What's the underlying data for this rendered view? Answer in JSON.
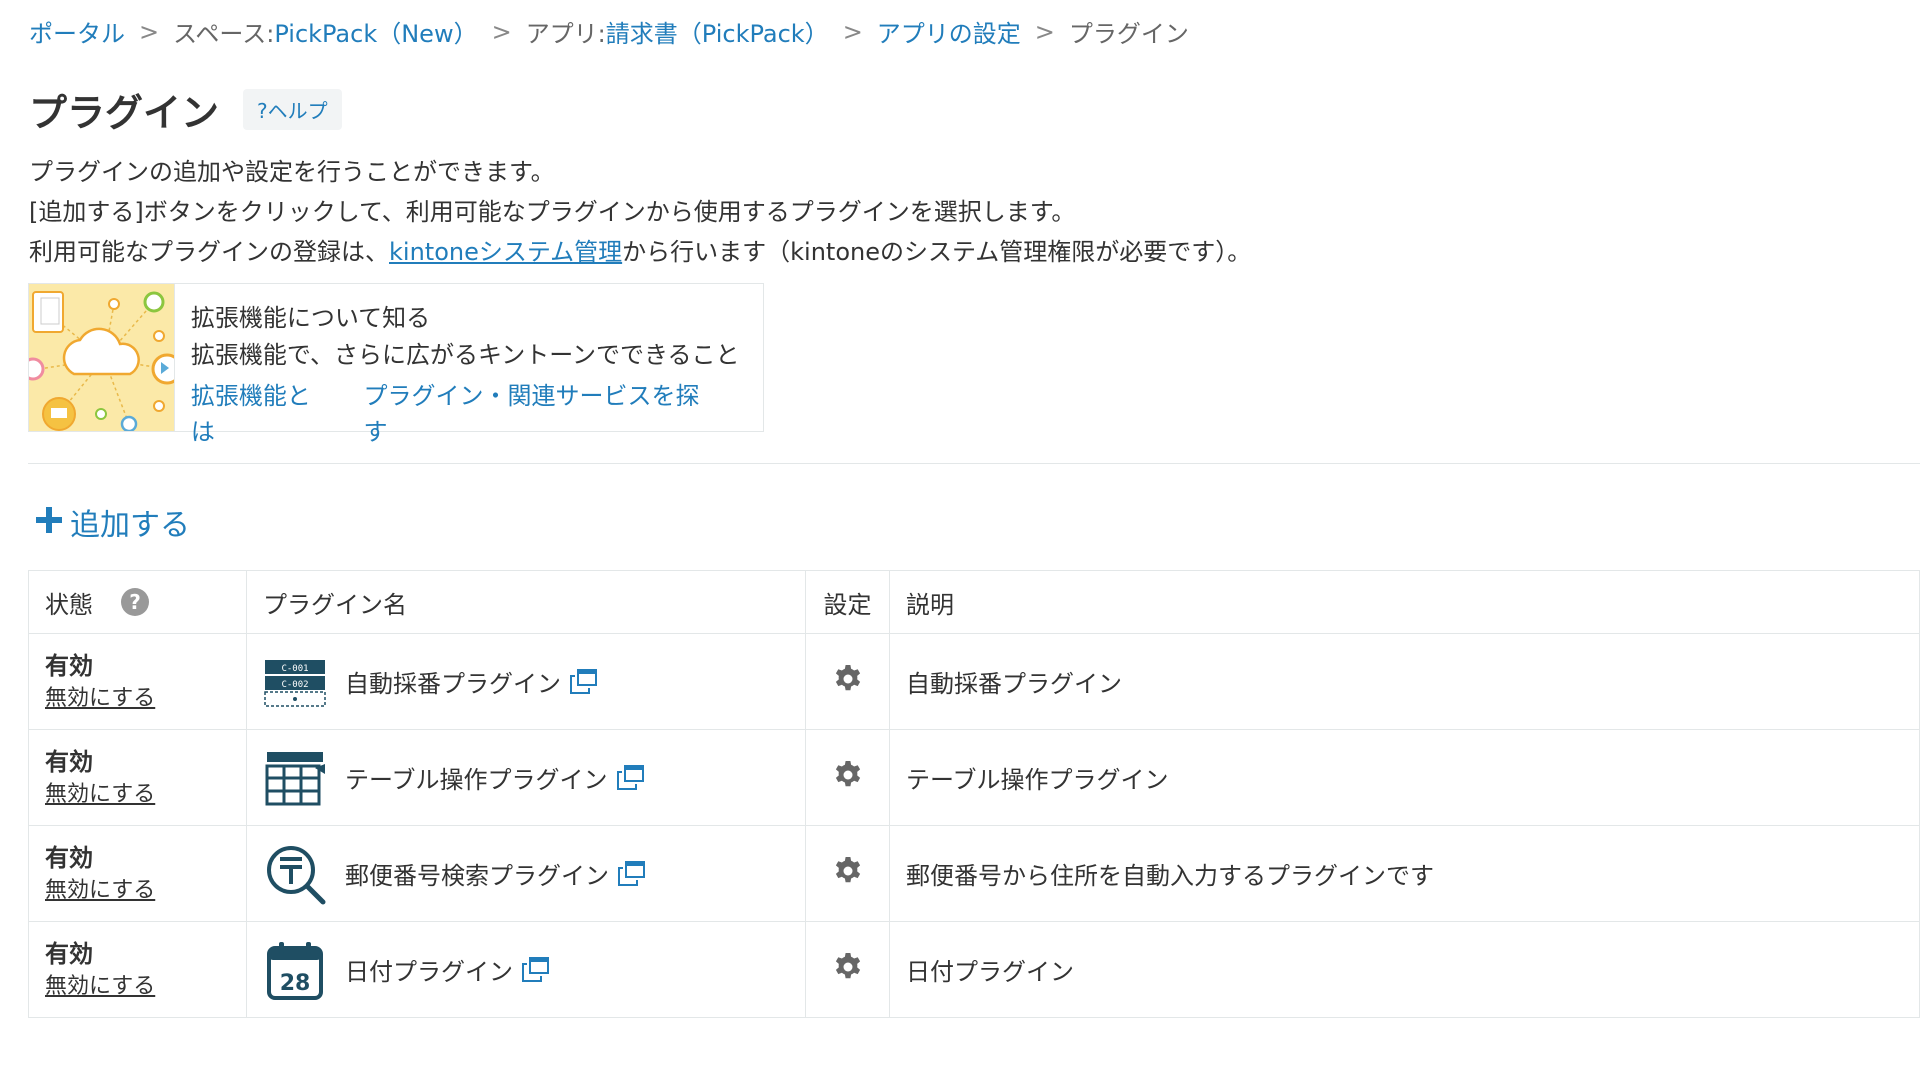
{
  "breadcrumb": {
    "portal": "ポータル",
    "sep": ">",
    "space_prefix": "スペース: ",
    "space": "PickPack（New）",
    "app_prefix": "アプリ: ",
    "app": "請求書（PickPack）",
    "settings": "アプリの設定",
    "current": "プラグイン"
  },
  "header": {
    "title": "プラグイン",
    "help": "?ヘルプ"
  },
  "description": {
    "line1": "プラグインの追加や設定を行うことができます。",
    "line2": "[追加する]ボタンをクリックして、利用可能なプラグインから使用するプラグインを選択します。",
    "line3_prefix": "利用可能なプラグインの登録は、",
    "line3_link": "kintoneシステム管理",
    "line3_suffix": "から行います（kintoneのシステム管理権限が必要です）。"
  },
  "promo": {
    "title": "拡張機能について知る",
    "subtitle": "拡張機能で、さらに広がるキントーンでできること",
    "link1": "拡張機能とは",
    "link2": "プラグイン・関連サービスを探す"
  },
  "add_button": {
    "icon": "plus-icon",
    "label": "追加する"
  },
  "table": {
    "headers": {
      "status": "状態",
      "name": "プラグイン名",
      "settings": "設定",
      "description": "説明"
    },
    "rows": [
      {
        "status": "有効",
        "action": "無効にする",
        "name": "自動採番プラグイン",
        "icon": "auto-numbering-icon",
        "description": "自動採番プラグイン"
      },
      {
        "status": "有効",
        "action": "無効にする",
        "name": "テーブル操作プラグイン",
        "icon": "table-icon",
        "description": "テーブル操作プラグイン"
      },
      {
        "status": "有効",
        "action": "無効にする",
        "name": "郵便番号検索プラグイン",
        "icon": "postal-search-icon",
        "description": "郵便番号から住所を自動入力するプラグインです"
      },
      {
        "status": "有効",
        "action": "無効にする",
        "name": "日付プラグイン",
        "icon": "calendar-icon",
        "calendar_day": "28",
        "description": "日付プラグイン"
      }
    ]
  },
  "colors": {
    "link": "#217dbb",
    "border": "#e3e7e8",
    "icon_dark": "#1f4e63"
  }
}
